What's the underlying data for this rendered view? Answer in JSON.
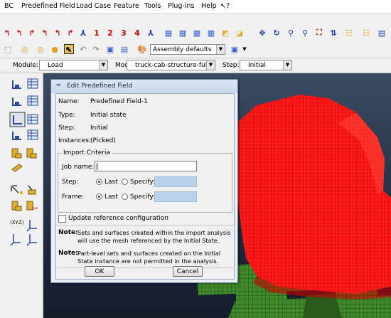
{
  "menu": {
    "items": [
      "BC",
      "Predefined Field",
      "Load Case",
      "Feature",
      "Tools",
      "Plug-ins",
      "Help"
    ],
    "whats_this": "↖?"
  },
  "toolbar": {
    "numbers": [
      "1",
      "2",
      "3",
      "4"
    ],
    "assembly_select": "Assembly defaults"
  },
  "context": {
    "module_label": "Module:",
    "module_value": "Load",
    "model_label": "Model:",
    "model_value": "truck-cab-structure-full",
    "step_label": "Step:",
    "step_value": "Initial"
  },
  "dialog": {
    "title": "Edit Predefined Field",
    "name_label": "Name:",
    "name_value": "Predefined Field-1",
    "type_label": "Type:",
    "type_value": "Initial state",
    "step_label": "Step:",
    "step_value": "Initial",
    "instances_label": "Instances:",
    "instances_value": "(Picked)",
    "group_title": "Import Criteria",
    "job_name_label": "Job name:",
    "job_name_value": "",
    "step_row_label": "Step:",
    "frame_row_label": "Frame:",
    "last_label": "Last",
    "specify_label": "Specify:",
    "update_checkbox_label": "Update reference configuration",
    "note1_label": "Note:",
    "note1_line1": "Sets and surfaces created within the import analysis",
    "note1_line2": "will use the mesh referenced by the Initial State.",
    "note2_label": "Note:",
    "note2_line1": "Part-level sets and surfaces created on the Initial",
    "note2_line2": "State instance are not permitted in the analysis.",
    "ok_label": "OK",
    "cancel_label": "Cancel"
  },
  "viewport": {
    "mesh_red": "#ff1a1a",
    "mesh_green": "#3f8a2a"
  }
}
